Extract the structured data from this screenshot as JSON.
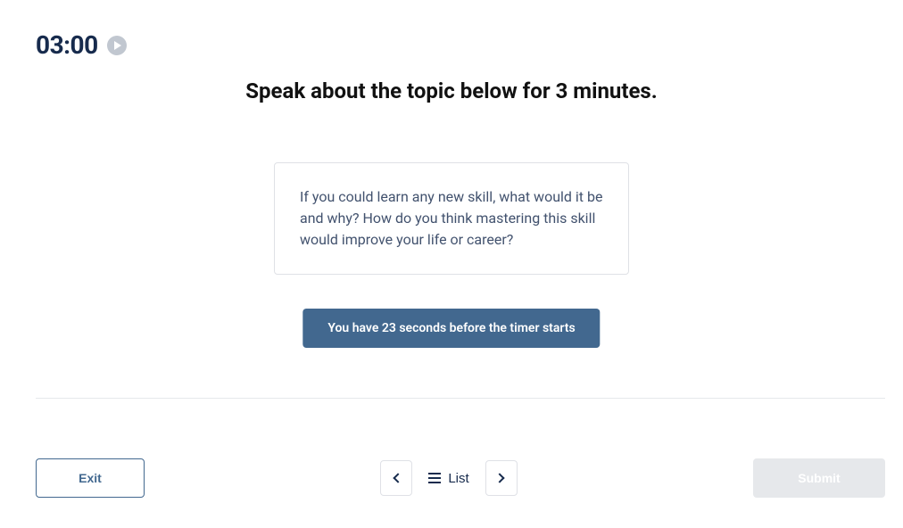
{
  "timer": {
    "display": "03:00"
  },
  "instruction": "Speak about the topic below for 3 minutes.",
  "topic": "If you could learn any new skill, what would it be and why? How do you think mastering this skill would improve your life or career?",
  "countdown": "You have 23 seconds before the timer starts",
  "footer": {
    "exit_label": "Exit",
    "list_label": "List",
    "submit_label": "Submit"
  }
}
